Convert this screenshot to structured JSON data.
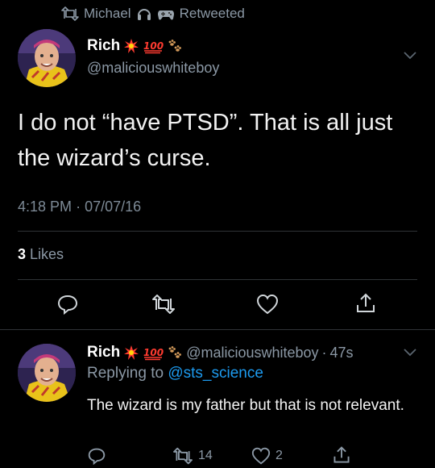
{
  "retweet": {
    "name": "Michael",
    "label": "Retweeted",
    "name_emojis": [
      "headphones-emoji",
      "game-controller-emoji"
    ]
  },
  "main_tweet": {
    "name": "Rich",
    "name_emojis": [
      "collision-emoji",
      "hundred-points-emoji",
      "paw-prints-emoji"
    ],
    "handle": "@maliciouswhiteboy",
    "text": "I do not “have PTSD”. That is all just the wizard’s curse.",
    "time": "4:18 PM",
    "date_sep": "·",
    "date": "07/07/16",
    "likes_count": "3",
    "likes_label": "Likes"
  },
  "reply_tweet": {
    "name": "Rich",
    "name_emojis": [
      "collision-emoji",
      "hundred-points-emoji",
      "paw-prints-emoji"
    ],
    "handle": "@maliciouswhiteboy",
    "time_sep": "·",
    "time": "47s",
    "replying_to_label": "Replying to",
    "replying_to_handle": "@sts_science",
    "text": "The wizard is my father but that is not relevant.",
    "retweet_count": "14",
    "like_count": "2"
  },
  "colors": {
    "background": "#000000",
    "text": "#f2f2f2",
    "muted": "#8b98a5",
    "link": "#1d9bf0",
    "divider": "#2f3336"
  }
}
